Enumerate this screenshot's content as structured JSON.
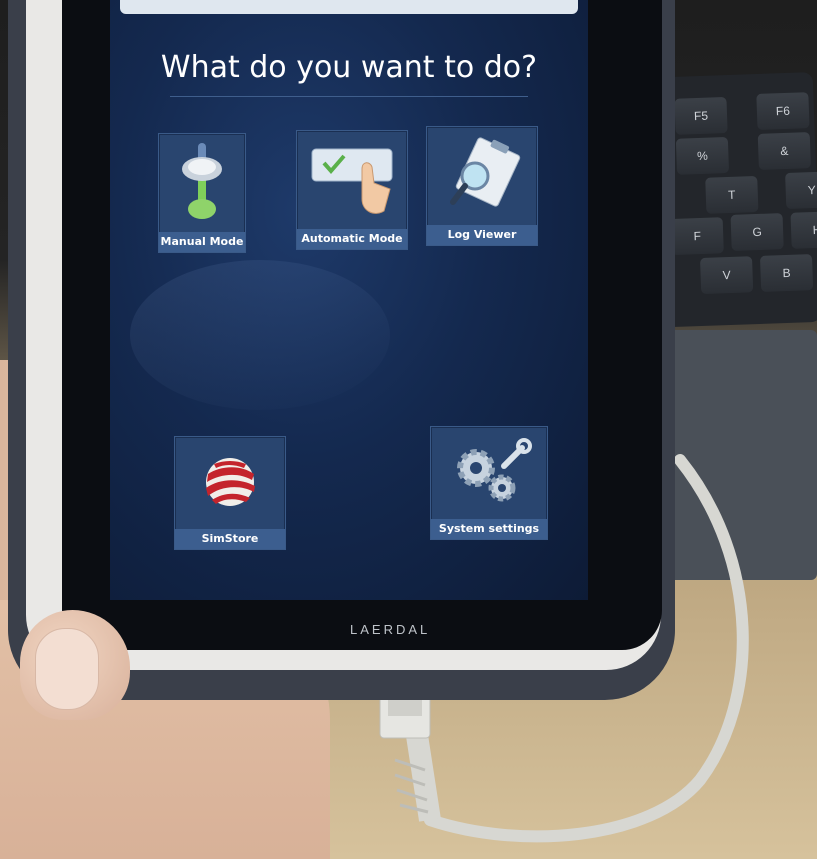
{
  "screen": {
    "title": "What do you want to do?"
  },
  "device": {
    "brand": "LAERDAL"
  },
  "tiles": [
    {
      "label": "Manual Mode",
      "icon": "slider-icon"
    },
    {
      "label": "Automatic Mode",
      "icon": "hand-touch-checkbox-icon"
    },
    {
      "label": "Log Viewer",
      "icon": "clipboard-magnifier-icon"
    },
    {
      "label": "SimStore",
      "icon": "striped-globe-icon"
    },
    {
      "label": "System settings",
      "icon": "gears-wrench-icon"
    }
  ],
  "keyboard": {
    "keys": [
      "F5",
      "F6",
      "%",
      "&",
      "T",
      "Y",
      "F",
      "G",
      "H",
      "V",
      "B"
    ]
  },
  "colors": {
    "screen_bg": "#14294f",
    "tile_bg": "#29456f",
    "tile_label_bg": "#3c5e8f",
    "text": "#ffffff"
  }
}
